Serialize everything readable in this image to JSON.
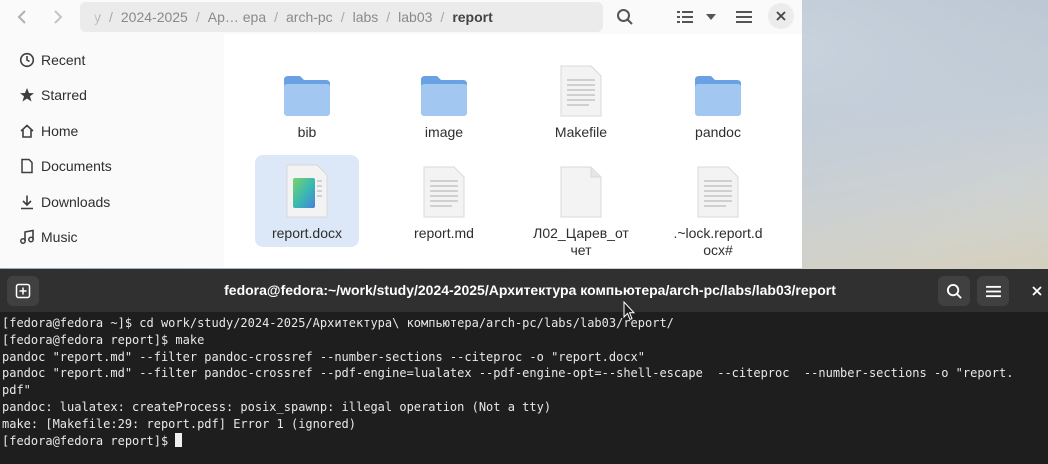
{
  "file_manager": {
    "path_segments": [
      "y",
      "2024-2025",
      "Ар… ера",
      "arch-pc",
      "labs",
      "lab03"
    ],
    "current_folder": "report",
    "sidebar": [
      {
        "label": "Recent",
        "icon": "clock-icon"
      },
      {
        "label": "Starred",
        "icon": "star-icon"
      },
      {
        "label": "Home",
        "icon": "home-icon"
      },
      {
        "label": "Documents",
        "icon": "document-icon"
      },
      {
        "label": "Downloads",
        "icon": "download-icon"
      },
      {
        "label": "Music",
        "icon": "music-icon"
      }
    ],
    "files": [
      {
        "name": "bib",
        "kind": "folder"
      },
      {
        "name": "image",
        "kind": "folder"
      },
      {
        "name": "Makefile",
        "kind": "text"
      },
      {
        "name": "pandoc",
        "kind": "folder"
      },
      {
        "name": "report.docx",
        "kind": "docx",
        "selected": true
      },
      {
        "name": "report.md",
        "kind": "text"
      },
      {
        "name": "Л02_Царев_от\nчет",
        "kind": "blank"
      },
      {
        "name": ".~lock.report.d\nocx#",
        "kind": "text"
      }
    ]
  },
  "terminal": {
    "title": "fedora@fedora:~/work/study/2024-2025/Архитектура компьютера/arch-pc/labs/lab03/report",
    "lines": [
      "[fedora@fedora ~]$ cd work/study/2024-2025/Архитектура\\ компьютера/arch-pc/labs/lab03/report/",
      "[fedora@fedora report]$ make",
      "pandoc \"report.md\" --filter pandoc-crossref --number-sections --citeproc -o \"report.docx\"",
      "pandoc \"report.md\" --filter pandoc-crossref --pdf-engine=lualatex --pdf-engine-opt=--shell-escape  --citeproc  --number-sections -o \"report.",
      "pdf\"",
      "pandoc: lualatex: createProcess: posix_spawnp: illegal operation (Not a tty)",
      "make: [Makefile:29: report.pdf] Error 1 (ignored)"
    ],
    "prompt": "[fedora@fedora report]$ "
  }
}
